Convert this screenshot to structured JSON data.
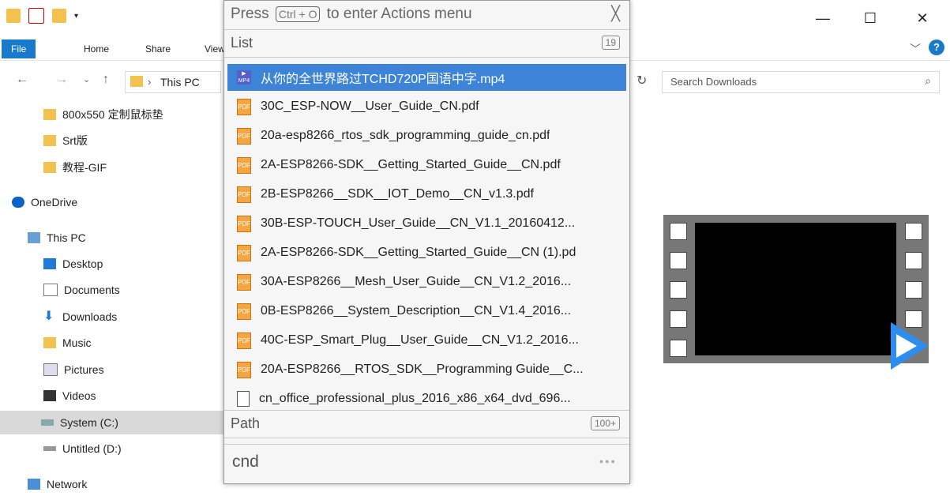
{
  "window": {
    "tabs": [
      "File",
      "Home",
      "Share",
      "View"
    ],
    "address": "This PC",
    "search_placeholder": "Search Downloads",
    "controls": {
      "minimize": "—",
      "maximize": "☐",
      "close": "✕"
    }
  },
  "sidebar": {
    "items": [
      {
        "label": "800x550 定制鼠标垫",
        "icon": "folder-icon"
      },
      {
        "label": "Srt版",
        "icon": "folder-icon"
      },
      {
        "label": "教程-GIF",
        "icon": "folder-icon"
      },
      {
        "label": "OneDrive",
        "icon": "cloud-icon"
      },
      {
        "label": "This PC",
        "icon": "pc-icon"
      },
      {
        "label": "Desktop",
        "icon": "desktop-icon"
      },
      {
        "label": "Documents",
        "icon": "documents-icon"
      },
      {
        "label": "Downloads",
        "icon": "downloads-icon"
      },
      {
        "label": "Music",
        "icon": "music-icon"
      },
      {
        "label": "Pictures",
        "icon": "pictures-icon"
      },
      {
        "label": "Videos",
        "icon": "videos-icon"
      },
      {
        "label": "System (C:)",
        "icon": "drive-icon"
      },
      {
        "label": "Untitled (D:)",
        "icon": "drive-icon"
      },
      {
        "label": "Network",
        "icon": "network-icon"
      }
    ]
  },
  "actions": {
    "hint_prefix": "Press",
    "hint_key": "Ctrl + O",
    "hint_suffix": "to enter Actions menu",
    "close": "╳",
    "list_label": "List",
    "list_count": "19",
    "path_label": "Path",
    "path_count": "100+",
    "query": "cnd",
    "more": "●●●",
    "items": [
      {
        "name": "从你的全世界路过TCHD720P国语中字.mp4",
        "type": "mp4"
      },
      {
        "name": "30C_ESP-NOW__User_Guide_CN.pdf",
        "type": "pdf"
      },
      {
        "name": "20a-esp8266_rtos_sdk_programming_guide_cn.pdf",
        "type": "pdf"
      },
      {
        "name": "2A-ESP8266-SDK__Getting_Started_Guide__CN.pdf",
        "type": "pdf"
      },
      {
        "name": "2B-ESP8266__SDK__IOT_Demo__CN_v1.3.pdf",
        "type": "pdf"
      },
      {
        "name": "30B-ESP-TOUCH_User_Guide__CN_V1.1_20160412...",
        "type": "pdf"
      },
      {
        "name": "2A-ESP8266-SDK__Getting_Started_Guide__CN (1).pd",
        "type": "pdf"
      },
      {
        "name": "30A-ESP8266__Mesh_User_Guide__CN_V1.2_2016...",
        "type": "pdf"
      },
      {
        "name": "0B-ESP8266__System_Description__CN_V1.4_2016...",
        "type": "pdf"
      },
      {
        "name": "40C-ESP_Smart_Plug__User_Guide__CN_V1.2_2016...",
        "type": "pdf"
      },
      {
        "name": "20A-ESP8266__RTOS_SDK__Programming Guide__C...",
        "type": "pdf"
      },
      {
        "name": "cn_office_professional_plus_2016_x86_x64_dvd_696...",
        "type": "file"
      }
    ]
  }
}
